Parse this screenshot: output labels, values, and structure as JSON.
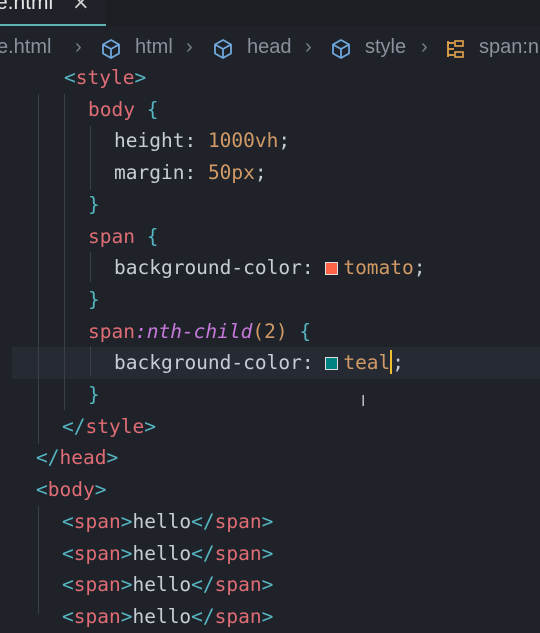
{
  "tab": {
    "label": "e.html",
    "close": "×"
  },
  "breadcrumb": {
    "items": [
      "e.html",
      "html",
      "head",
      "style",
      "span:n"
    ],
    "separator": "›"
  },
  "code_lines": [
    {
      "parts": [
        [
          "punc",
          "<"
        ],
        [
          "tag",
          "style"
        ],
        [
          "punc",
          ">"
        ]
      ]
    },
    {
      "parts": [
        [
          "tag",
          "body"
        ],
        [
          "prop",
          " "
        ],
        [
          "brace",
          "{"
        ]
      ]
    },
    {
      "parts": [
        [
          "prop",
          "height"
        ],
        [
          "colon",
          ": "
        ],
        [
          "num",
          "1000vh"
        ],
        [
          "colon",
          ";"
        ]
      ]
    },
    {
      "parts": [
        [
          "prop",
          "margin"
        ],
        [
          "colon",
          ": "
        ],
        [
          "num",
          "50px"
        ],
        [
          "colon",
          ";"
        ]
      ]
    },
    {
      "parts": [
        [
          "brace",
          "}"
        ]
      ]
    },
    {
      "parts": [
        [
          "tag",
          "span"
        ],
        [
          "prop",
          " "
        ],
        [
          "brace",
          "{"
        ]
      ]
    },
    {
      "parts": [
        [
          "prop",
          "background-color"
        ],
        [
          "colon",
          ": "
        ],
        [
          "swatch",
          "#ff6347"
        ],
        [
          "kw",
          "tomato"
        ],
        [
          "colon",
          ";"
        ]
      ]
    },
    {
      "parts": [
        [
          "brace",
          "}"
        ]
      ]
    },
    {
      "parts": [
        [
          "tag",
          "span"
        ],
        [
          "pseudo",
          ":nth-child"
        ],
        [
          "paren",
          "(2)"
        ],
        [
          "prop",
          " "
        ],
        [
          "brace",
          "{"
        ]
      ]
    },
    {
      "parts": [
        [
          "prop",
          "background-color"
        ],
        [
          "colon",
          ": "
        ],
        [
          "swatch",
          "#008080"
        ],
        [
          "kw",
          "teal"
        ],
        [
          "cursor",
          ""
        ],
        [
          "colon",
          ";"
        ]
      ]
    },
    {
      "parts": [
        [
          "brace",
          "}"
        ]
      ]
    },
    {
      "parts": [
        [
          "punc",
          "</"
        ],
        [
          "tag",
          "style"
        ],
        [
          "punc",
          ">"
        ]
      ]
    },
    {
      "parts": [
        [
          "punc",
          "</"
        ],
        [
          "tag",
          "head"
        ],
        [
          "punc",
          ">"
        ]
      ]
    },
    {
      "parts": [
        [
          "punc",
          "<"
        ],
        [
          "tag",
          "body"
        ],
        [
          "punc",
          ">"
        ]
      ]
    },
    {
      "parts": [
        [
          "punc",
          "<"
        ],
        [
          "tag",
          "span"
        ],
        [
          "punc",
          ">"
        ],
        [
          "prop",
          "hello"
        ],
        [
          "punc",
          "</"
        ],
        [
          "tag",
          "span"
        ],
        [
          "punc",
          ">"
        ]
      ]
    },
    {
      "parts": [
        [
          "punc",
          "<"
        ],
        [
          "tag",
          "span"
        ],
        [
          "punc",
          ">"
        ],
        [
          "prop",
          "hello"
        ],
        [
          "punc",
          "</"
        ],
        [
          "tag",
          "span"
        ],
        [
          "punc",
          ">"
        ]
      ]
    },
    {
      "parts": [
        [
          "punc",
          "<"
        ],
        [
          "tag",
          "span"
        ],
        [
          "punc",
          ">"
        ],
        [
          "prop",
          "hello"
        ],
        [
          "punc",
          "</"
        ],
        [
          "tag",
          "span"
        ],
        [
          "punc",
          ">"
        ]
      ]
    },
    {
      "parts": [
        [
          "punc",
          "<"
        ],
        [
          "tag",
          "span"
        ],
        [
          "punc",
          ">"
        ],
        [
          "prop",
          "hello"
        ],
        [
          "punc",
          "</"
        ],
        [
          "tag",
          "span"
        ],
        [
          "punc",
          ">"
        ]
      ]
    }
  ],
  "colors": {
    "tomato_swatch": "#ff6347",
    "teal_swatch": "#008080",
    "background": "#1f2329",
    "cursor": "#f0c030"
  },
  "icons": [
    "close-icon",
    "cube-icon",
    "cube-icon",
    "cube-icon",
    "brackets-icon",
    "text-cursor-icon"
  ]
}
